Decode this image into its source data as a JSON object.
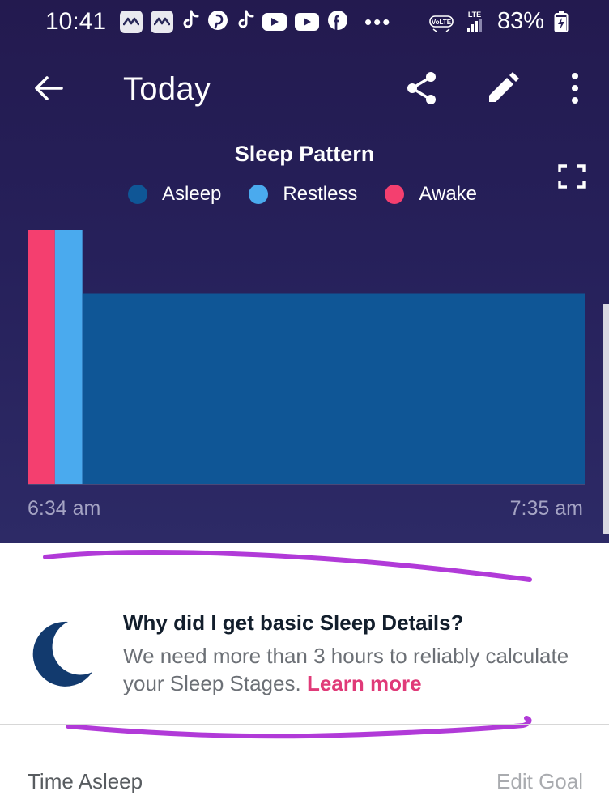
{
  "status_bar": {
    "time": "10:41",
    "battery": "83%",
    "network": "LTE",
    "volte": "VoLTE",
    "app_icons": [
      "fitbit-icon",
      "fitbit-icon",
      "tiktok-icon",
      "pinterest-icon",
      "tiktok-icon",
      "youtube-icon",
      "youtube-icon",
      "facebook-icon"
    ]
  },
  "app_bar": {
    "title": "Today"
  },
  "chart_data": {
    "type": "bar",
    "title": "Sleep Pattern",
    "legend": [
      {
        "name": "Asleep",
        "color": "#0f5696"
      },
      {
        "name": "Restless",
        "color": "#4aaaee"
      },
      {
        "name": "Awake",
        "color": "#f43f6f"
      }
    ],
    "x_start_label": "6:34 am",
    "x_end_label": "7:35 am",
    "x_range_minutes": [
      0,
      61
    ],
    "y_levels": {
      "Awake": 1.0,
      "Restless": 1.0,
      "Asleep": 0.75
    },
    "segments": [
      {
        "stage": "Awake",
        "start_min": 0,
        "end_min": 3
      },
      {
        "stage": "Restless",
        "start_min": 3,
        "end_min": 6
      },
      {
        "stage": "Asleep",
        "start_min": 6,
        "end_min": 61
      }
    ],
    "legend_position": "top-center",
    "grid": false
  },
  "info": {
    "heading": "Why did I get basic Sleep Details?",
    "body": "We need more than 3 hours to reliably calculate your Sleep Stages.",
    "link": "Learn more"
  },
  "footer": {
    "left_label": "Time Asleep",
    "right_action": "Edit Goal"
  },
  "colors": {
    "background_top": "#261f58",
    "link": "#e03a78",
    "annotation_marker": "#b13ad8"
  }
}
